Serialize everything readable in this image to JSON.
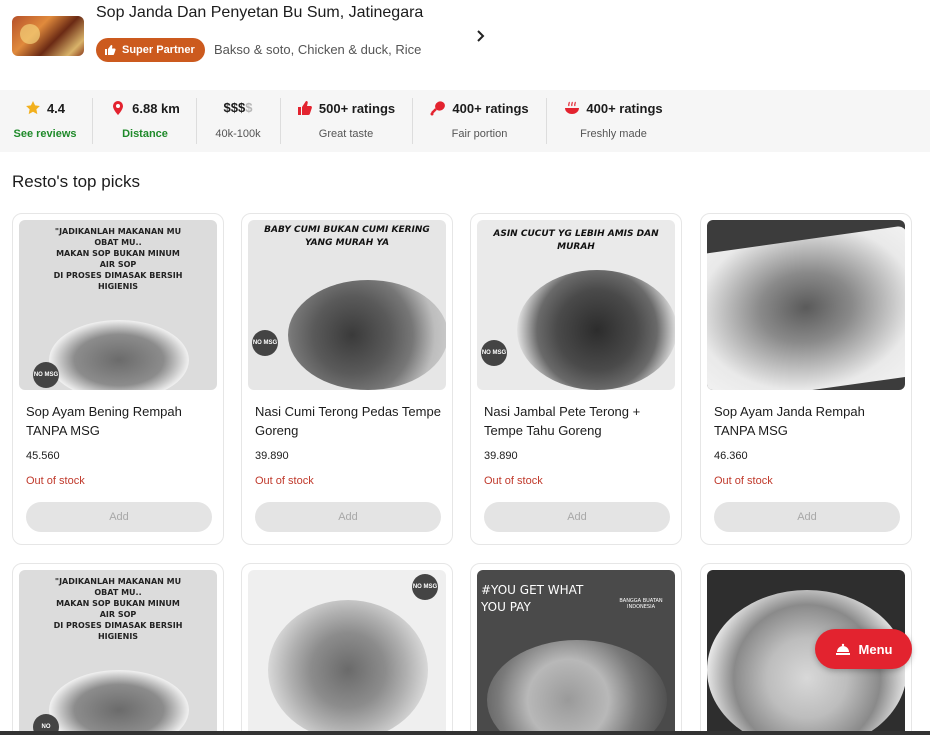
{
  "restaurant": {
    "name": "Sop Janda Dan Penyetan Bu Sum, Jatinegara",
    "badge": "Super Partner",
    "cuisines": "Bakso & soto, Chicken & duck, Rice"
  },
  "stats": [
    {
      "value": "4.4",
      "label": "See reviews",
      "icon": "star-icon",
      "color": "#f2b01e"
    },
    {
      "value": "6.88 km",
      "label": "Distance",
      "icon": "location-pin-icon",
      "color": "#e3232f"
    },
    {
      "value_main": "$$$",
      "value_dim": "$",
      "label": "40k-100k"
    },
    {
      "value": "500+ ratings",
      "label": "Great taste",
      "icon": "thumbs-up-icon",
      "color": "#e3232f"
    },
    {
      "value": "400+ ratings",
      "label": "Fair portion",
      "icon": "drumstick-icon",
      "color": "#e3232f"
    },
    {
      "value": "400+ ratings",
      "label": "Freshly made",
      "icon": "bowl-icon",
      "color": "#e3232f"
    }
  ],
  "section_title": "Resto's top picks",
  "items": [
    {
      "name": "Sop Ayam Bening Rempah TANPA MSG",
      "price": "45.560",
      "status": "Out of stock",
      "button": "Add",
      "img_text": [
        "\"JADIKANLAH MAKANAN MU",
        "OBAT MU..",
        "MAKAN SOP BUKAN MINUM",
        "AIR SOP",
        "DI PROSES DIMASAK BERSIH",
        "HIGIENIS"
      ],
      "img_badge": "NO MSG"
    },
    {
      "name": "Nasi Cumi Terong Pedas Tempe Goreng",
      "price": "39.890",
      "status": "Out of stock",
      "button": "Add",
      "img_banner": "BABY CUMI BUKAN CUMI KERING YANG MURAH YA",
      "img_badge": "NO MSG"
    },
    {
      "name": "Nasi Jambal Pete Terong + Tempe Tahu Goreng",
      "price": "39.890",
      "status": "Out of stock",
      "button": "Add",
      "img_banner": "ASIN CUCUT YG LEBIH AMIS DAN MURAH",
      "img_badge": "NO MSG"
    },
    {
      "name": "Sop Ayam Janda Rempah TANPA MSG",
      "price": "46.360",
      "status": "Out of stock",
      "button": "Add"
    }
  ],
  "row2": [
    {
      "img_text": [
        "\"JADIKANLAH MAKANAN MU",
        "OBAT MU..",
        "MAKAN SOP BUKAN MINUM",
        "AIR SOP",
        "DI PROSES DIMASAK BERSIH",
        "HIGIENIS"
      ],
      "img_badge": "NO"
    },
    {
      "img_badge": "NO MSG"
    },
    {
      "img_banner": "#YOU GET WHAT YOU PAY",
      "img_logo": "BANGGA BUATAN INDONESIA"
    },
    {}
  ],
  "menu_button": "Menu",
  "colors": {
    "brand_red": "#e3232f",
    "badge_orange": "#cc5a1e",
    "stock_red": "#c0392b",
    "green": "#1f8a2a"
  }
}
